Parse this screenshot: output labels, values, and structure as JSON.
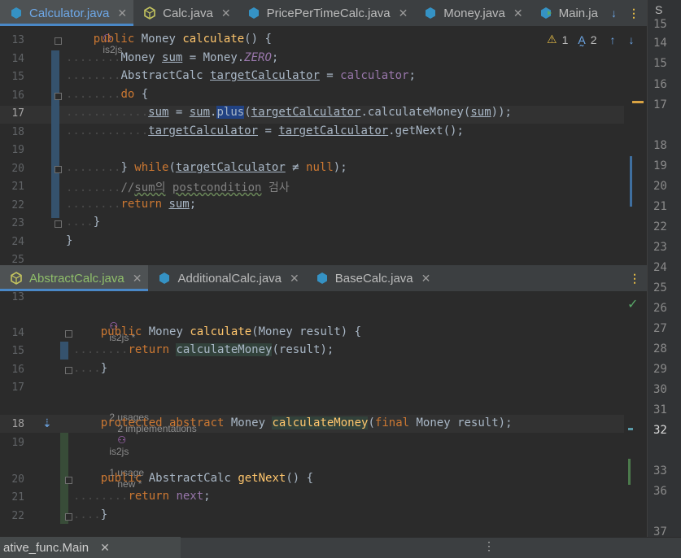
{
  "top_tabs": [
    {
      "label": "Calculator.java",
      "icon": "java-class-icon",
      "active": true
    },
    {
      "label": "Calc.java",
      "icon": "interface-icon",
      "active": false
    },
    {
      "label": "PricePerTimeCalc.java",
      "icon": "java-class-icon",
      "active": false
    },
    {
      "label": "Money.java",
      "icon": "java-class-icon",
      "active": false
    },
    {
      "label": "Main.ja",
      "icon": "main-class-icon",
      "active": false
    }
  ],
  "top_pane": {
    "author_hint": "is2js",
    "inspections": {
      "warnings": "1",
      "typos": "2"
    },
    "line_numbers": [
      "13",
      "14",
      "15",
      "16",
      "17",
      "18",
      "19",
      "20",
      "21",
      "22",
      "23",
      "24",
      "25"
    ]
  },
  "bottom_tabs": [
    {
      "label": "AbstractCalc.java",
      "icon": "interface-icon",
      "active": true
    },
    {
      "label": "AdditionalCalc.java",
      "icon": "java-class-icon",
      "active": false
    },
    {
      "label": "BaseCalc.java",
      "icon": "java-class-icon",
      "active": false
    }
  ],
  "bottom_pane": {
    "author_hint": "is2js *",
    "usage_hint": {
      "usages": "2 usages",
      "impls": "2 implementations",
      "author": "is2js"
    },
    "usage_hint2": {
      "usages": "1 usage",
      "author": "new *"
    },
    "line_numbers": [
      "13",
      "14",
      "15",
      "16",
      "17",
      "18",
      "19",
      "20",
      "21",
      "22"
    ]
  },
  "right_numbers": [
    "15",
    "14",
    "15",
    "16",
    "17",
    "18",
    "19",
    "20",
    "21",
    "22",
    "23",
    "24",
    "25",
    "26",
    "27",
    "28",
    "29",
    "30",
    "31",
    "32",
    "33",
    "36",
    "37"
  ],
  "bottom_bar": {
    "run_tab": "ative_func.Main"
  },
  "colors": {
    "accent": "#4a88c7",
    "keyword": "#cc7832",
    "method": "#ffc66d",
    "field": "#9876aa"
  }
}
